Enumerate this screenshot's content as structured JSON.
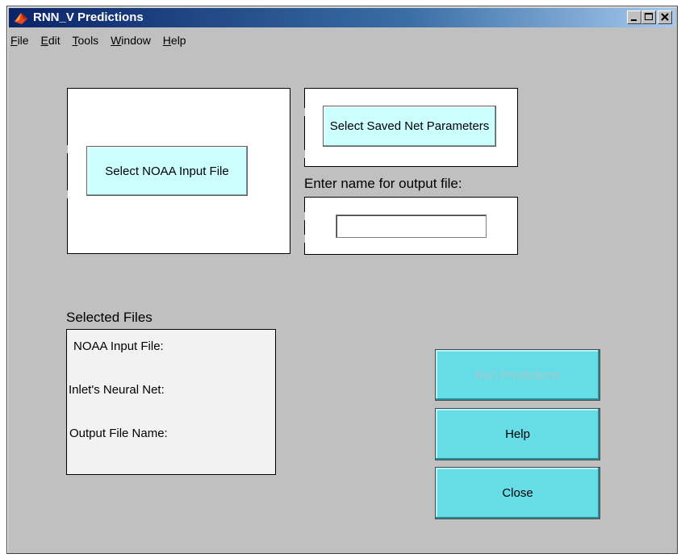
{
  "window": {
    "title": "RNN_V Predictions",
    "icon": "matlab-icon",
    "controls": [
      "minimize",
      "maximize",
      "close"
    ]
  },
  "menubar": {
    "items": [
      {
        "label_u": "F",
        "label_rest": "ile"
      },
      {
        "label_u": "E",
        "label_rest": "dit"
      },
      {
        "label_u": "T",
        "label_rest": "ools"
      },
      {
        "label_u": "W",
        "label_rest": "indow"
      },
      {
        "label_u": "H",
        "label_rest": "elp"
      }
    ]
  },
  "main": {
    "noaa_button": "Select NOAA Input File",
    "saved_net_button": "Select Saved Net Parameters",
    "output_prompt": "Enter name for output file:",
    "output_value": "",
    "selected_files_title": "Selected Files",
    "selected_files": {
      "noaa": "NOAA Input File:",
      "neural_net": "Inlet's Neural Net:",
      "output": "Output File Name:"
    },
    "run_button": "Run Predictions",
    "help_button": "Help",
    "close_button": "Close"
  },
  "colors": {
    "window_bg": "#c0c0c0",
    "button_light": "#ccffff",
    "button_action": "#66dde6",
    "title_start": "#0a246a"
  }
}
